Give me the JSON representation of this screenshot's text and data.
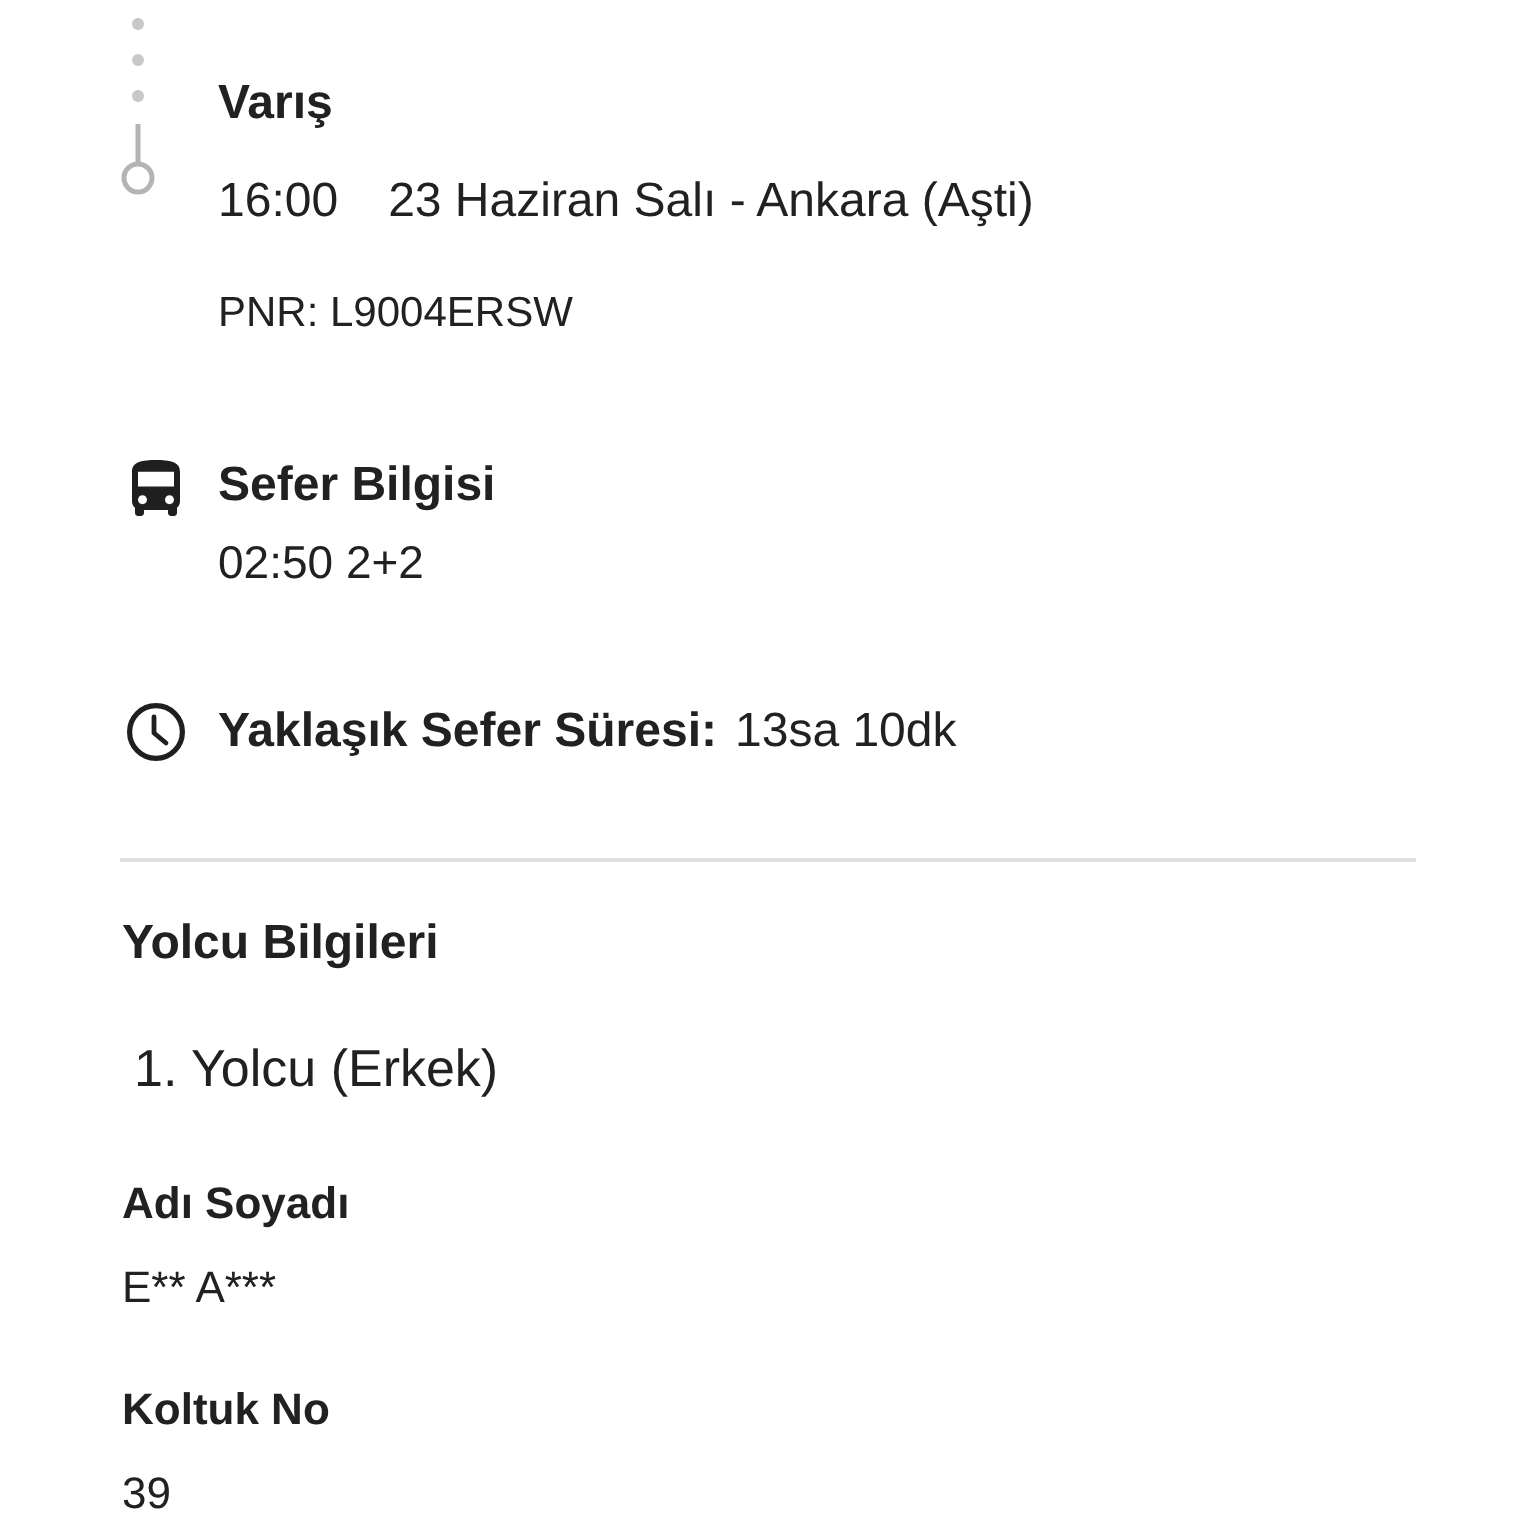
{
  "arrival": {
    "title": "Varış",
    "time": "16:00",
    "details": "23 Haziran Salı - Ankara (Aşti)",
    "pnr": "PNR: L9004ERSW"
  },
  "trip_info": {
    "title": "Sefer Bilgisi",
    "value": "02:50 2+2"
  },
  "duration": {
    "label": "Yaklaşık Sefer Süresi:",
    "value": "13sa 10dk"
  },
  "passengers": {
    "title": "Yolcu Bilgileri",
    "items": [
      {
        "heading": "1. Yolcu (Erkek)",
        "fields": [
          {
            "label": "Adı Soyadı",
            "value": "E** A***"
          },
          {
            "label": "Koltuk No",
            "value": "39"
          }
        ]
      }
    ]
  }
}
